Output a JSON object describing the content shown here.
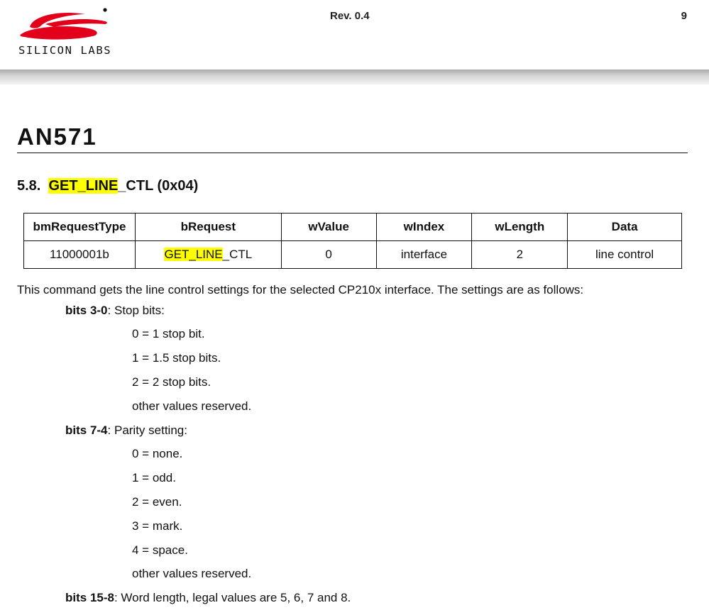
{
  "header": {
    "logo_text": "SILICON LABS",
    "revision": "Rev. 0.4",
    "page_number": "9",
    "brand_color": "#e3001b"
  },
  "document": {
    "title": "AN571",
    "section": {
      "number": "5.8.",
      "name_highlighted": "GET_LINE",
      "name_rest": "_CTL (0x04)"
    }
  },
  "table": {
    "headers": [
      "bmRequestType",
      "bRequest",
      "wValue",
      "wIndex",
      "wLength",
      "Data"
    ],
    "row": {
      "bmRequestType": "11000001b",
      "bRequest_highlighted": "GET_LINE",
      "bRequest_rest": "_CTL",
      "wValue": "0",
      "wIndex": "interface",
      "wLength": "2",
      "data": "line control"
    }
  },
  "intro": "This command gets the line control settings for the selected CP210x interface. The settings are as follows:",
  "fields": [
    {
      "label": "bits 3-0",
      "description": ": Stop bits:",
      "values": [
        "0 = 1 stop bit.",
        "1 = 1.5 stop bits.",
        "2 = 2 stop bits.",
        "other values reserved."
      ]
    },
    {
      "label": "bits 7-4",
      "description": ": Parity setting:",
      "values": [
        "0 = none.",
        "1 = odd.",
        "2 = even.",
        "3 = mark.",
        "4 = space.",
        "other values reserved."
      ]
    },
    {
      "label": "bits 15-8",
      "description": ": Word length, legal values are 5, 6, 7 and 8.",
      "values": []
    }
  ],
  "highlight_color": "#ffff00"
}
